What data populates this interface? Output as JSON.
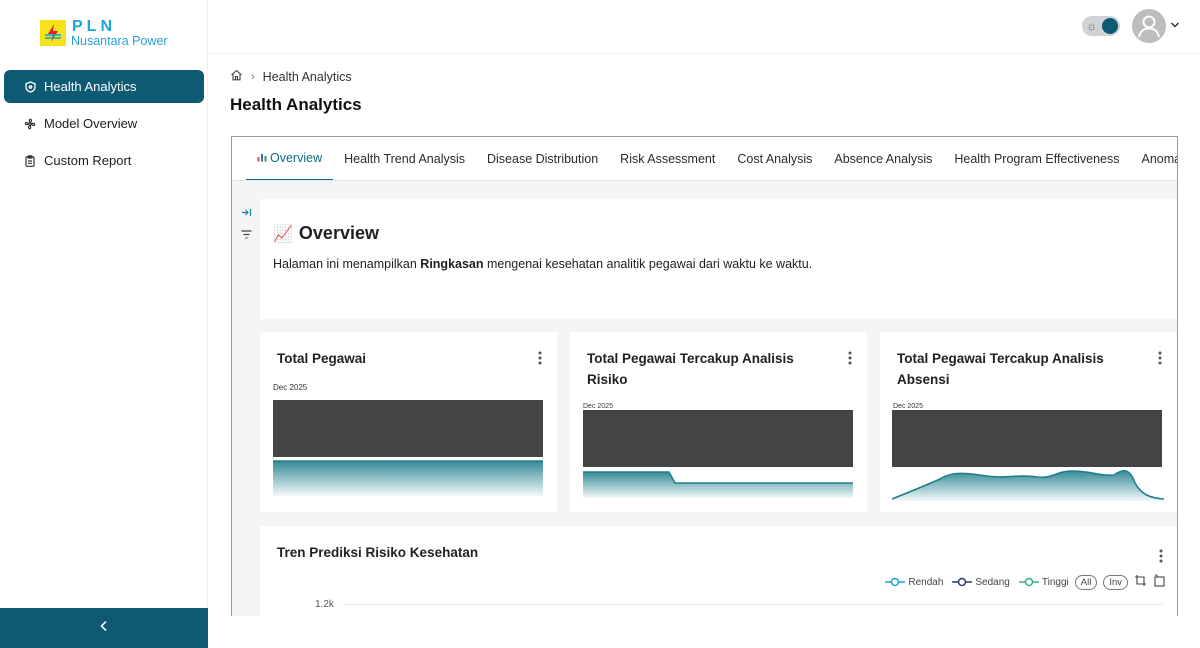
{
  "brand": {
    "name": "PLN",
    "subtitle": "Nusantara Power"
  },
  "sidebar": {
    "items": [
      {
        "label": "Health Analytics",
        "icon": "shield-icon",
        "active": true
      },
      {
        "label": "Model Overview",
        "icon": "fan-icon",
        "active": false
      },
      {
        "label": "Custom Report",
        "icon": "clipboard-icon",
        "active": false
      }
    ],
    "collapse_icon": "chevron-left-icon"
  },
  "header": {
    "theme_toggle": "dark",
    "user_icon": "user-avatar-icon"
  },
  "breadcrumb": {
    "current": "Health Analytics"
  },
  "page_title": "Health Analytics",
  "tabs": [
    {
      "label": "Overview",
      "active": true
    },
    {
      "label": "Health Trend Analysis"
    },
    {
      "label": "Disease Distribution"
    },
    {
      "label": "Risk Assessment"
    },
    {
      "label": "Cost Analysis"
    },
    {
      "label": "Absence Analysis"
    },
    {
      "label": "Health Program Effectiveness"
    },
    {
      "label": "Anoma"
    }
  ],
  "overview": {
    "emoji": "📈",
    "title": "Overview",
    "desc_prefix": "Halaman ini menampilkan ",
    "desc_bold": "Ringkasan",
    "desc_suffix": " mengenai kesehatan analitik pegawai dari waktu ke waktu."
  },
  "kpis": [
    {
      "title": "Total Pegawai",
      "date": "Dec 2025"
    },
    {
      "title": "Total Pegawai Tercakup Analisis Risiko",
      "date": "Dec 2025"
    },
    {
      "title": "Total Pegawai Tercakup Analisis Absensi",
      "date": "Dec 2025"
    }
  ],
  "trend": {
    "title": "Tren Prediksi Risiko Kesehatan",
    "legend": [
      {
        "name": "Rendah",
        "color": "#1aa3c8"
      },
      {
        "name": "Sedang",
        "color": "#2d3a6e"
      },
      {
        "name": "Tinggi",
        "color": "#33b08a"
      }
    ],
    "pill_all": "All",
    "pill_inv": "Inv",
    "y_tick_top": "1.2k"
  },
  "colors": {
    "primary": "#0e5a73",
    "accent": "#0e6c86",
    "spark": "#1e7e8c",
    "block": "#444444"
  }
}
